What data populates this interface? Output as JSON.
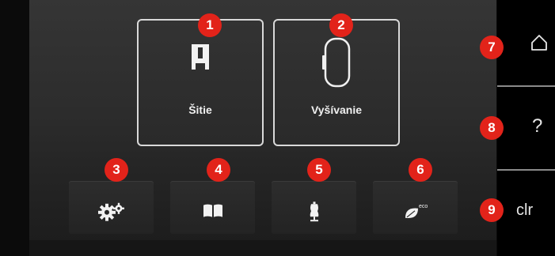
{
  "modes": {
    "sewing": {
      "label": "Šitie",
      "icon": "presser-foot-icon"
    },
    "embroidery": {
      "label": "Vyšívanie",
      "icon": "embroidery-hoop-icon"
    }
  },
  "toolbar": [
    {
      "icon": "gears-icon"
    },
    {
      "icon": "book-icon"
    },
    {
      "icon": "dress-form-icon"
    },
    {
      "icon": "eco-leaf-icon",
      "badge_text": "eco"
    }
  ],
  "sidebar": {
    "home_icon": "home-icon",
    "help_label": "?",
    "clear_label": "clr"
  },
  "callouts": [
    "1",
    "2",
    "3",
    "4",
    "5",
    "6",
    "7",
    "8",
    "9"
  ],
  "colors": {
    "callout": "#e2231a",
    "tile_border": "#d9d9d9",
    "text": "#f0f0f0"
  }
}
